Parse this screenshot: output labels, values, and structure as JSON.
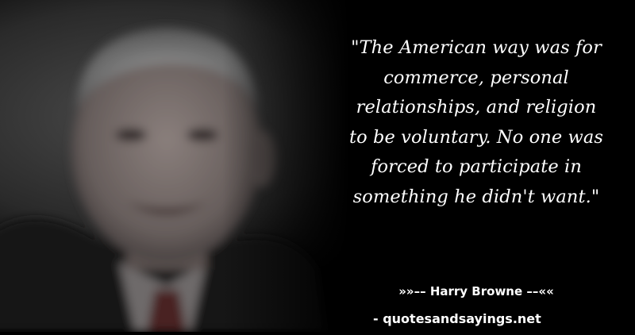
{
  "quote": {
    "lines": [
      "\"The American way was for",
      "commerce, personal",
      "relationships, and religion",
      "to be voluntary. No one was",
      "forced to participate in",
      "something he didn't want.\""
    ]
  },
  "attribution": {
    "text": "»»–– Harry Browne ––««"
  },
  "source": {
    "text": "- quotesandsayings.net"
  },
  "colors": {
    "background": "#000000",
    "text": "#ffffff"
  }
}
